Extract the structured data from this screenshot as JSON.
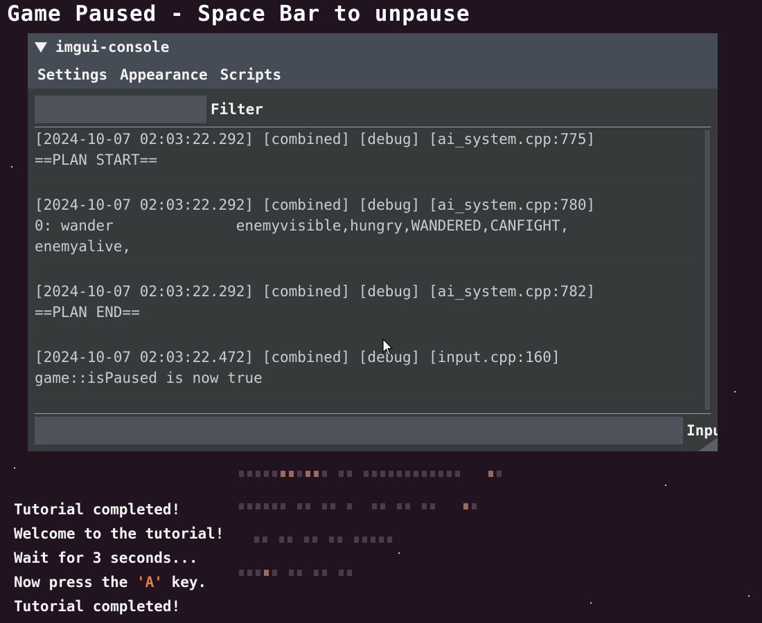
{
  "banner": {
    "text": "Game Paused - Space Bar to unpause"
  },
  "console": {
    "title": "imgui-console",
    "menu": [
      {
        "label": "Settings"
      },
      {
        "label": "Appearance"
      },
      {
        "label": "Scripts"
      }
    ],
    "filter": {
      "label": "Filter",
      "value": ""
    },
    "logs": [
      {
        "lines": [
          "[2024-10-07 02:03:22.292] [combined] [debug] [ai_system.cpp:775]",
          "==PLAN START=="
        ]
      },
      {
        "lines": [
          "[2024-10-07 02:03:22.292] [combined] [debug] [ai_system.cpp:780]",
          "0: wander              enemyvisible,hungry,WANDERED,CANFIGHT,",
          "enemyalive,"
        ]
      },
      {
        "lines": [
          "[2024-10-07 02:03:22.292] [combined] [debug] [ai_system.cpp:782]",
          "==PLAN END=="
        ]
      },
      {
        "lines": [
          "[2024-10-07 02:03:22.472] [combined] [debug] [input.cpp:160]",
          "game::isPaused is now true"
        ]
      }
    ],
    "input": {
      "label": "Input",
      "value": ""
    }
  },
  "tutorial": {
    "lines": [
      {
        "text": "Tutorial completed!"
      },
      {
        "text": "Welcome to the tutorial!"
      },
      {
        "text": "Wait for 3 seconds..."
      },
      {
        "pre": "Now press the ",
        "key": "'A'",
        "post": " key."
      },
      {
        "text": "Tutorial completed!"
      }
    ]
  },
  "colors": {
    "background": "#21131f",
    "console_body": "#383b3b",
    "console_header": "#464c56",
    "log_text": "#c9cdd0",
    "key_highlight": "#e2813c",
    "map_tile_purple": "#4e3a4f",
    "map_tile_orange": "#9a6a5c"
  }
}
